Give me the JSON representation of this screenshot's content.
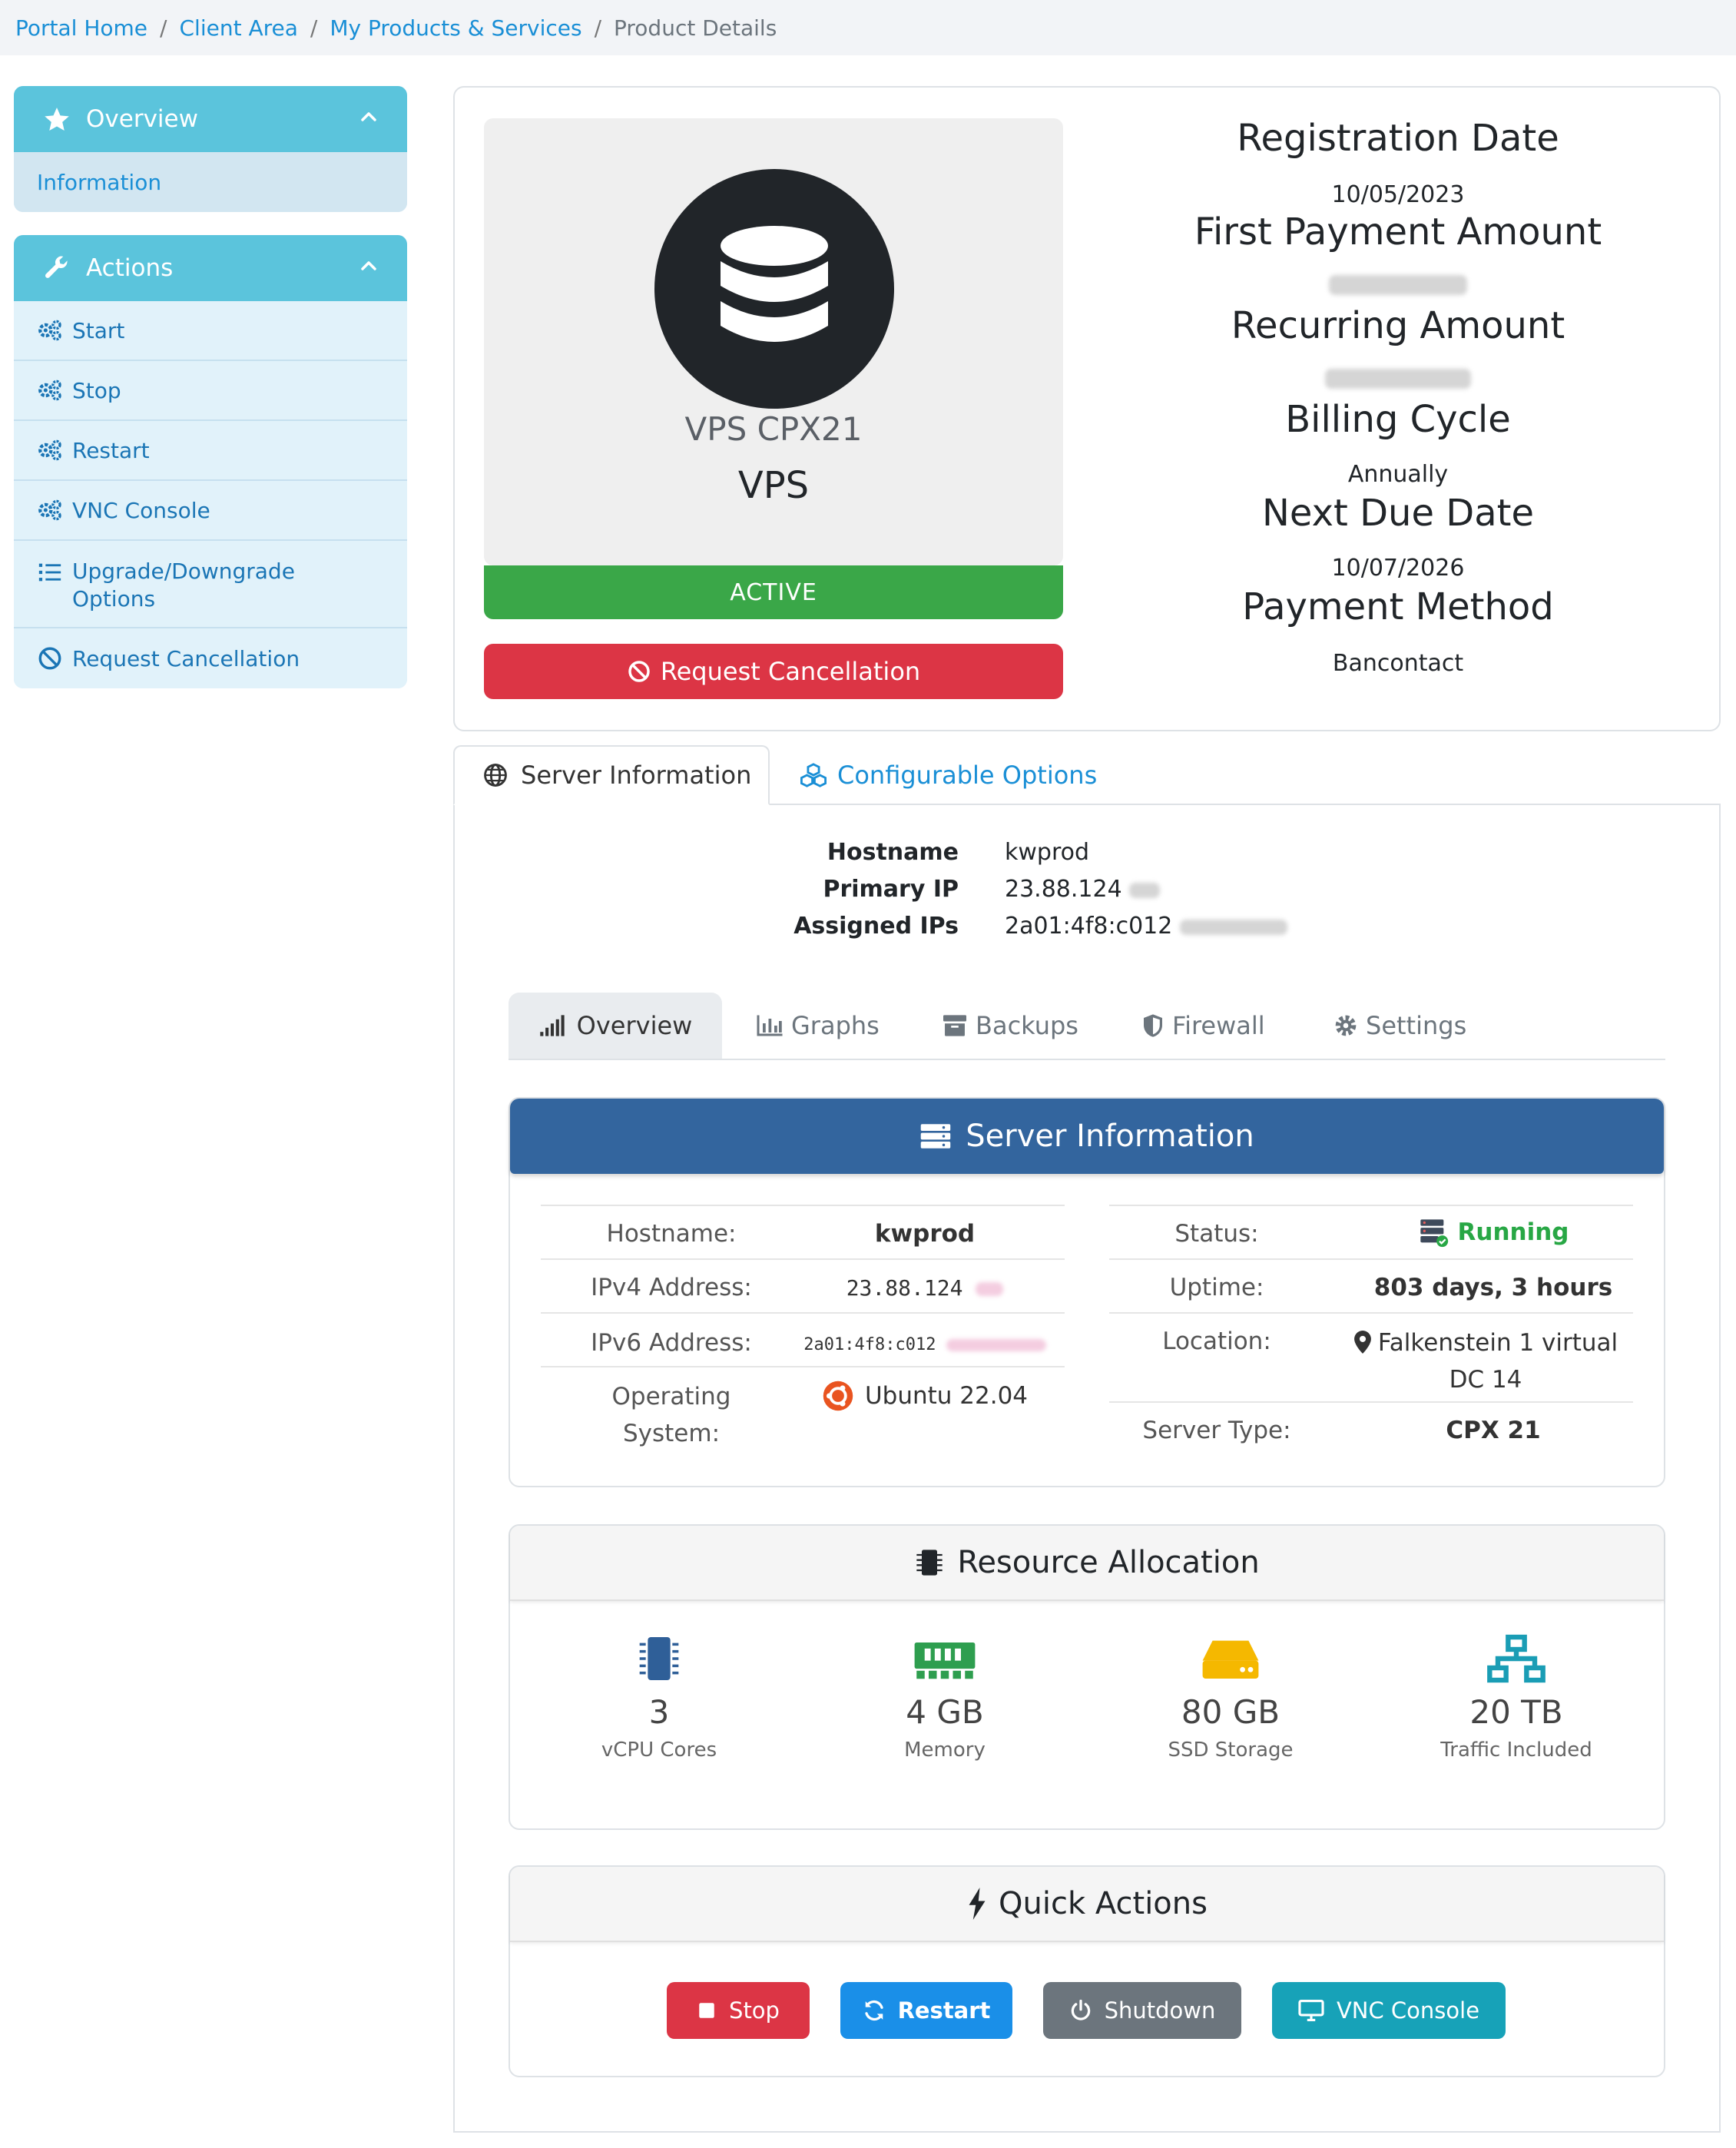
{
  "breadcrumb": {
    "home": "Portal Home",
    "client_area": "Client Area",
    "products": "My Products & Services",
    "current": "Product Details"
  },
  "sidebar": {
    "overview_title": "Overview",
    "overview_items": [
      "Information"
    ],
    "actions_title": "Actions",
    "action_items": [
      "Start",
      "Stop",
      "Restart",
      "VNC Console",
      "Upgrade/Downgrade Options",
      "Request Cancellation"
    ]
  },
  "product": {
    "name": "VPS CPX21",
    "group": "VPS",
    "status": "ACTIVE",
    "cancel_label": "Request Cancellation"
  },
  "billing": {
    "registration_date_label": "Registration Date",
    "registration_date": "10/05/2023",
    "first_payment_label": "First Payment Amount",
    "recurring_label": "Recurring Amount",
    "billing_cycle_label": "Billing Cycle",
    "billing_cycle": "Annually",
    "next_due_label": "Next Due Date",
    "next_due": "10/07/2026",
    "payment_method_label": "Payment Method",
    "payment_method": "Bancontact"
  },
  "tabs": {
    "server_info": "Server Information",
    "configurable": "Configurable Options"
  },
  "host_info": {
    "hostname_label": "Hostname",
    "hostname": "kwprod",
    "primary_ip_label": "Primary IP",
    "primary_ip": "23.88.124",
    "assigned_ips_label": "Assigned IPs",
    "assigned_ips": "2a01:4f8:c012"
  },
  "subtabs": [
    "Overview",
    "Graphs",
    "Backups",
    "Firewall",
    "Settings"
  ],
  "server_panel": {
    "title": "Server Information",
    "hostname_label": "Hostname:",
    "hostname": "kwprod",
    "ipv4_label": "IPv4 Address:",
    "ipv4": "23.88.124",
    "ipv6_label": "IPv6 Address:",
    "ipv6": "2a01:4f8:c012",
    "os_label_1": "Operating",
    "os_label_2": "System:",
    "os": "Ubuntu 22.04",
    "status_label": "Status:",
    "status": "Running",
    "uptime_label": "Uptime:",
    "uptime": "803 days, 3 hours",
    "location_label": "Location:",
    "location_1": "Falkenstein 1 virtual",
    "location_2": "DC 14",
    "server_type_label": "Server Type:",
    "server_type": "CPX 21"
  },
  "resources": {
    "title": "Resource Allocation",
    "items": [
      {
        "value": "3",
        "label": "vCPU Cores",
        "icon": "cpu-icon",
        "color": "#2f5f98"
      },
      {
        "value": "4 GB",
        "label": "Memory",
        "icon": "memory-icon",
        "color": "#2e9e4f"
      },
      {
        "value": "80 GB",
        "label": "SSD Storage",
        "icon": "hdd-icon",
        "color": "#f5b800"
      },
      {
        "value": "20 TB",
        "label": "Traffic Included",
        "icon": "network-icon",
        "color": "#1a9db5"
      }
    ]
  },
  "quick_actions": {
    "title": "Quick Actions",
    "stop": "Stop",
    "restart": "Restart",
    "shutdown": "Shutdown",
    "vnc": "VNC Console"
  },
  "colors": {
    "link": "#1a8fd6",
    "sidebar_head": "#5bc4dc",
    "active": "#3aa748",
    "danger": "#dc3545",
    "primary_panel": "#33659e"
  }
}
